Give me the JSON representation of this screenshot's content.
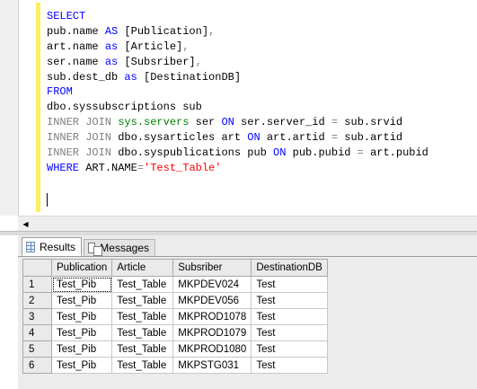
{
  "editor": {
    "lines": [
      [
        {
          "t": "SELECT",
          "c": "kw"
        }
      ],
      [
        {
          "t": "pub.name ",
          "c": ""
        },
        {
          "t": "AS",
          "c": "kw"
        },
        {
          "t": " [Publication]",
          "c": ""
        },
        {
          "t": ",",
          "c": "gr"
        }
      ],
      [
        {
          "t": "art.name ",
          "c": ""
        },
        {
          "t": "as",
          "c": "kw"
        },
        {
          "t": " [Article]",
          "c": ""
        },
        {
          "t": ",",
          "c": "gr"
        }
      ],
      [
        {
          "t": "ser.name ",
          "c": ""
        },
        {
          "t": "as",
          "c": "kw"
        },
        {
          "t": " [Subsriber]",
          "c": ""
        },
        {
          "t": ",",
          "c": "gr"
        }
      ],
      [
        {
          "t": "sub.dest_db ",
          "c": ""
        },
        {
          "t": "as",
          "c": "kw"
        },
        {
          "t": " [DestinationDB]",
          "c": ""
        }
      ],
      [
        {
          "t": "FROM",
          "c": "kw"
        }
      ],
      [
        {
          "t": "dbo.syssubscriptions sub",
          "c": ""
        }
      ],
      [
        {
          "t": "INNER JOIN ",
          "c": "gr"
        },
        {
          "t": "sys.servers",
          "c": "gn"
        },
        {
          "t": " ser ",
          "c": ""
        },
        {
          "t": "ON",
          "c": "kw"
        },
        {
          "t": " ser.server_id ",
          "c": ""
        },
        {
          "t": "=",
          "c": "gr"
        },
        {
          "t": " sub.srvid",
          "c": ""
        }
      ],
      [
        {
          "t": "INNER JOIN ",
          "c": "gr"
        },
        {
          "t": "dbo.sysarticles art ",
          "c": ""
        },
        {
          "t": "ON",
          "c": "kw"
        },
        {
          "t": " art.artid ",
          "c": ""
        },
        {
          "t": "=",
          "c": "gr"
        },
        {
          "t": " sub.artid",
          "c": ""
        }
      ],
      [
        {
          "t": "INNER JOIN ",
          "c": "gr"
        },
        {
          "t": "dbo.syspublications pub ",
          "c": ""
        },
        {
          "t": "ON",
          "c": "kw"
        },
        {
          "t": " pub.pubid ",
          "c": ""
        },
        {
          "t": "=",
          "c": "gr"
        },
        {
          "t": " art.pubid",
          "c": ""
        }
      ],
      [
        {
          "t": "WHERE",
          "c": "kw"
        },
        {
          "t": " ART.NAME",
          "c": ""
        },
        {
          "t": "=",
          "c": "gr"
        },
        {
          "t": "'Test_Table'",
          "c": "rd"
        }
      ]
    ]
  },
  "tabs": {
    "results_label": "Results",
    "messages_label": "Messages"
  },
  "grid": {
    "columns": [
      "Publication",
      "Article",
      "Subsriber",
      "DestinationDB"
    ],
    "rows": [
      {
        "num": "1",
        "cells": [
          "Test_Pib",
          "Test_Table",
          "MKPDEV024",
          "Test"
        ]
      },
      {
        "num": "2",
        "cells": [
          "Test_Pib",
          "Test_Table",
          "MKPDEV056",
          "Test"
        ]
      },
      {
        "num": "3",
        "cells": [
          "Test_Pib",
          "Test_Table",
          "MKPROD1078",
          "Test"
        ]
      },
      {
        "num": "4",
        "cells": [
          "Test_Pib",
          "Test_Table",
          "MKPROD1079",
          "Test"
        ]
      },
      {
        "num": "5",
        "cells": [
          "Test_Pib",
          "Test_Table",
          "MKPROD1080",
          "Test"
        ]
      },
      {
        "num": "6",
        "cells": [
          "Test_Pib",
          "Test_Table",
          "MKPSTG031",
          "Test"
        ]
      }
    ]
  }
}
